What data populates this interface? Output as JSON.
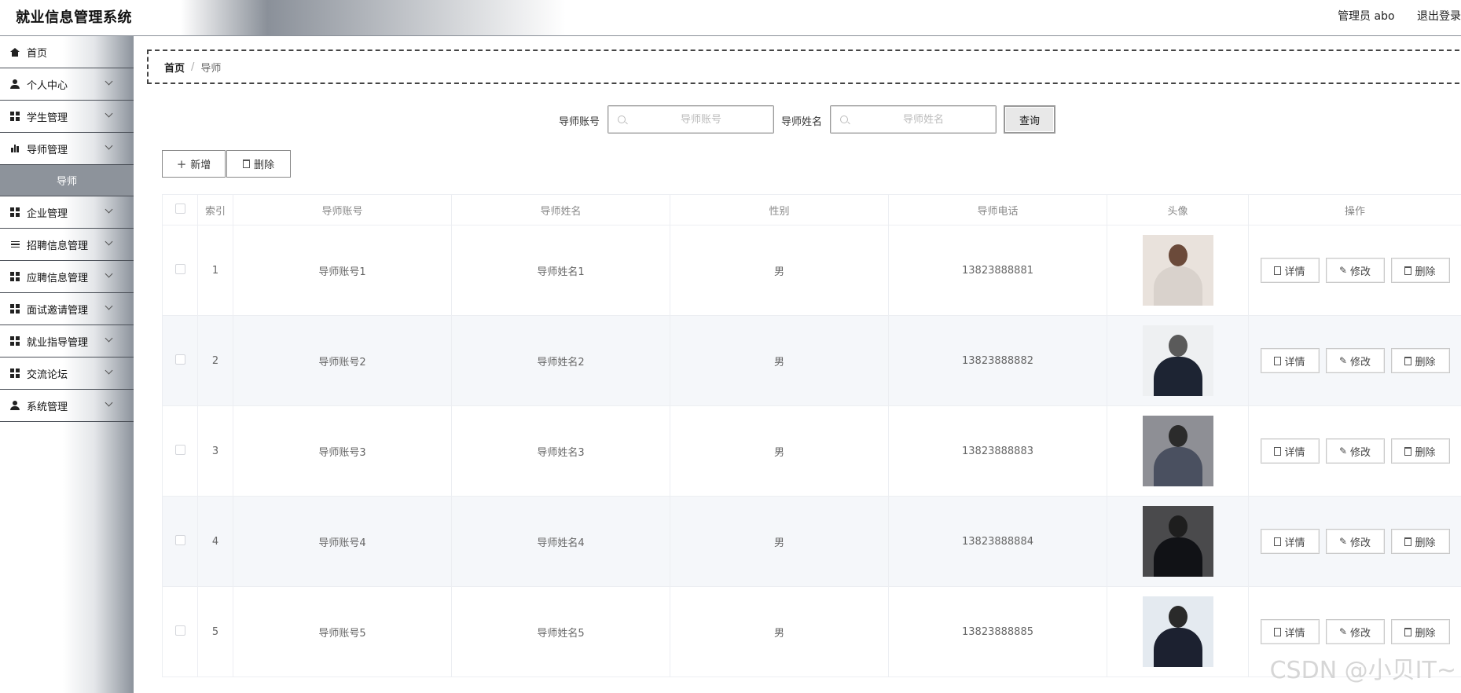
{
  "app": {
    "title": "就业信息管理系统"
  },
  "header": {
    "user_label": "管理员 abo",
    "logout_label": "退出登录"
  },
  "sidebar": {
    "items": [
      {
        "label": "首页",
        "icon": "home-icon"
      },
      {
        "label": "个人中心",
        "icon": "user-icon"
      },
      {
        "label": "学生管理",
        "icon": "grid-icon"
      },
      {
        "label": "导师管理",
        "icon": "bar-chart-icon"
      },
      {
        "label": "导师",
        "icon": "",
        "submenu": true,
        "active": true
      },
      {
        "label": "企业管理",
        "icon": "grid-icon"
      },
      {
        "label": "招聘信息管理",
        "icon": "list-icon"
      },
      {
        "label": "应聘信息管理",
        "icon": "grid-icon"
      },
      {
        "label": "面试邀请管理",
        "icon": "grid-icon"
      },
      {
        "label": "就业指导管理",
        "icon": "grid-icon"
      },
      {
        "label": "交流论坛",
        "icon": "grid-icon"
      },
      {
        "label": "系统管理",
        "icon": "user-icon"
      }
    ]
  },
  "breadcrumb": {
    "home": "首页",
    "separator": "/",
    "current": "导师"
  },
  "search": {
    "account_label": "导师账号",
    "account_placeholder": "导师账号",
    "account_value": "",
    "name_label": "导师姓名",
    "name_placeholder": "导师姓名",
    "name_value": "",
    "query_label": "查询"
  },
  "actions": {
    "add_label": "新增",
    "delete_label": "删除"
  },
  "table": {
    "columns": [
      "",
      "索引",
      "导师账号",
      "导师姓名",
      "性别",
      "导师电话",
      "头像",
      "操作"
    ],
    "row_actions": {
      "detail": "详情",
      "edit": "修改",
      "delete": "删除"
    },
    "rows": [
      {
        "index": "1",
        "account": "导师账号1",
        "name": "导师姓名1",
        "gender": "男",
        "phone": "13823888881",
        "avatar_colors": [
          "#e9e2dc",
          "#6b4a3a",
          "#d9d2cc"
        ]
      },
      {
        "index": "2",
        "account": "导师账号2",
        "name": "导师姓名2",
        "gender": "男",
        "phone": "13823888882",
        "avatar_colors": [
          "#eef0f2",
          "#5a5a5a",
          "#1d2433"
        ]
      },
      {
        "index": "3",
        "account": "导师账号3",
        "name": "导师姓名3",
        "gender": "男",
        "phone": "13823888883",
        "avatar_colors": [
          "#8e8f95",
          "#2b2b2b",
          "#4a5060"
        ]
      },
      {
        "index": "4",
        "account": "导师账号4",
        "name": "导师姓名4",
        "gender": "男",
        "phone": "13823888884",
        "avatar_colors": [
          "#4a4a4c",
          "#1e1e1e",
          "#111216"
        ]
      },
      {
        "index": "5",
        "account": "导师账号5",
        "name": "导师姓名5",
        "gender": "男",
        "phone": "13823888885",
        "avatar_colors": [
          "#e4eaf0",
          "#2a2a2a",
          "#1c2130"
        ]
      }
    ]
  },
  "watermark": "CSDN @小贝IT~"
}
